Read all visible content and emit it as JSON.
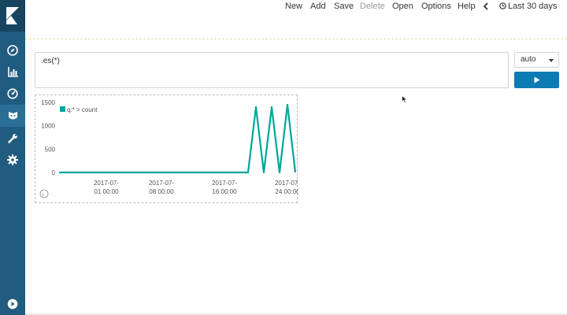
{
  "menu": {
    "new": "New",
    "add": "Add",
    "save": "Save",
    "delete": "Delete",
    "open": "Open",
    "options": "Options",
    "help": "Help",
    "time_range": "Last 30 days"
  },
  "sidebar": {
    "items": [
      {
        "icon": "compass-icon"
      },
      {
        "icon": "bar-chart-icon"
      },
      {
        "icon": "dashboard-icon"
      },
      {
        "icon": "timelion-icon"
      },
      {
        "icon": "wrench-icon"
      },
      {
        "icon": "gear-icon"
      },
      {
        "icon": "collapse-icon"
      }
    ]
  },
  "query": {
    "expression": ".es(*)",
    "interval": "auto"
  },
  "colors": {
    "sidebar": "#1f5c80",
    "accent": "#0c7bb3",
    "series": "#00a69b"
  },
  "chart_data": {
    "type": "line",
    "series": [
      {
        "name": "q:* > count",
        "points": [
          [
            "2017-06-25",
            0
          ],
          [
            "2017-07-01",
            0
          ],
          [
            "2017-07-08",
            0
          ],
          [
            "2017-07-16",
            0
          ],
          [
            "2017-07-19",
            0
          ],
          [
            "2017-07-20",
            1400
          ],
          [
            "2017-07-21",
            0
          ],
          [
            "2017-07-22",
            1400
          ],
          [
            "2017-07-23",
            0
          ],
          [
            "2017-07-24",
            1450
          ],
          [
            "2017-07-25",
            0
          ]
        ]
      }
    ],
    "y_ticks": [
      0,
      500,
      1000,
      1500
    ],
    "x_ticks": [
      {
        "date": "2017-07-01",
        "line1": "2017-07-",
        "line2": "01 00:00"
      },
      {
        "date": "2017-07-08",
        "line1": "2017-07-",
        "line2": "08 00:00"
      },
      {
        "date": "2017-07-16",
        "line1": "2017-07-",
        "line2": "16 00:00"
      },
      {
        "date": "2017-07-24",
        "line1": "2017-07-",
        "line2": "24 00:00"
      }
    ],
    "ylim": [
      0,
      1500
    ],
    "xlim": [
      "2017-06-25",
      "2017-07-25"
    ],
    "legend_position": "top-left"
  }
}
